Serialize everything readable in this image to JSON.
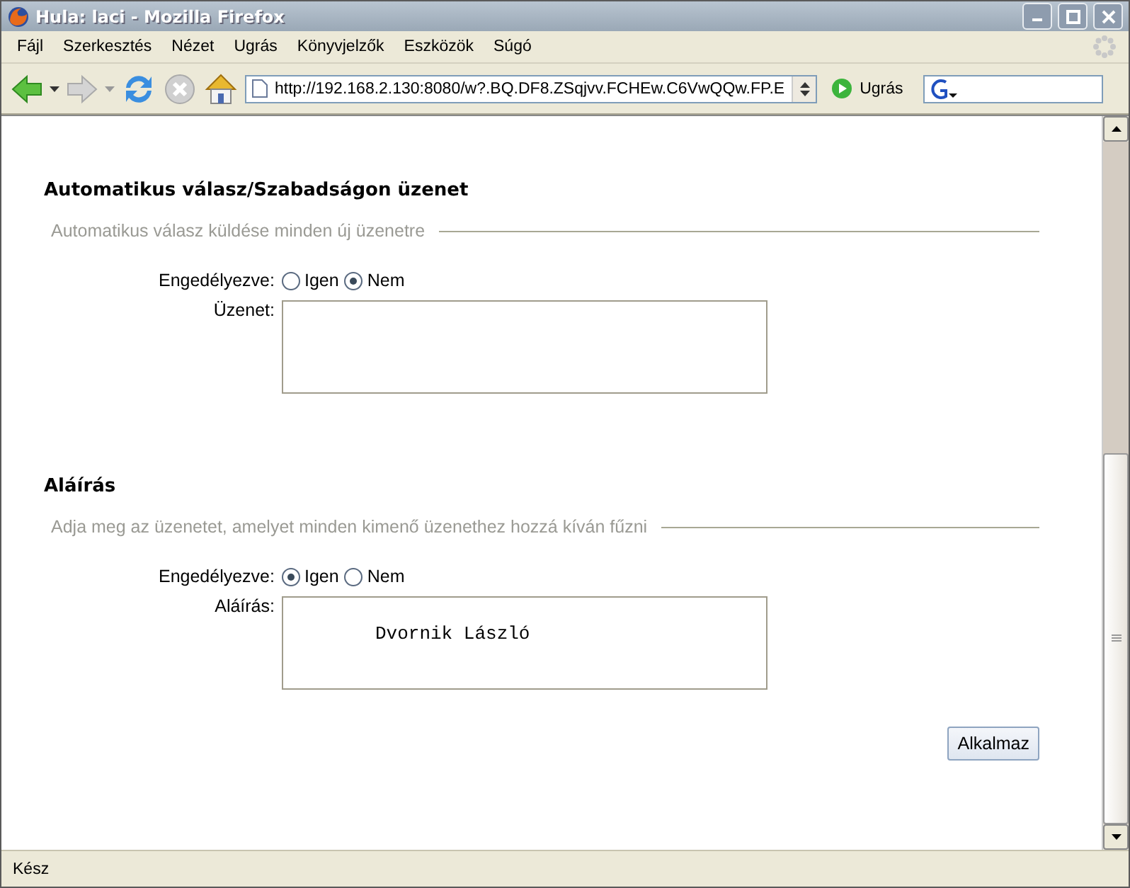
{
  "window": {
    "title": "Hula: laci - Mozilla Firefox"
  },
  "menu": [
    "Fájl",
    "Szerkesztés",
    "Nézet",
    "Ugrás",
    "Könyvjelzők",
    "Eszközök",
    "Súgó"
  ],
  "toolbar": {
    "url": "http://192.168.2.130:8080/w?.BQ.DF8.ZSqjvv.FCHEw.C6VwQQw.FP.E",
    "go_label": "Ugrás"
  },
  "sections": [
    {
      "title": "Automatikus válasz/Szabadságon üzenet",
      "legend": "Automatikus válasz küldése minden új üzenetre",
      "enabled_label": "Engedélyezve:",
      "options": [
        {
          "label": "Igen",
          "selected": false
        },
        {
          "label": "Nem",
          "selected": true
        }
      ],
      "field_label": "Üzenet:"
    },
    {
      "title": "Aláírás",
      "legend": "Adja meg az üzenetet, amelyet minden kimenő üzenethez hozzá kíván fűzni",
      "enabled_label": "Engedélyezve:",
      "options": [
        {
          "label": "Igen",
          "selected": true
        },
        {
          "label": "Nem",
          "selected": false
        }
      ],
      "field_label": "Aláírás:",
      "field_value": "Dvornik László"
    }
  ],
  "apply_button": "Alkalmaz",
  "status_bar": "Kész"
}
